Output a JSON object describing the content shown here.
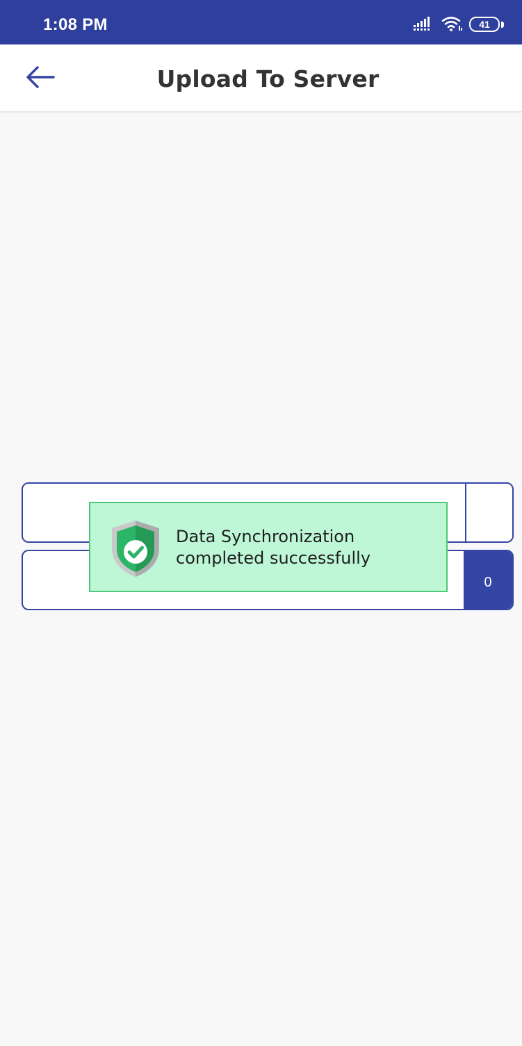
{
  "status_bar": {
    "time": "1:08 PM",
    "icons": [
      "signal-icon",
      "wifi-icon",
      "battery-icon"
    ],
    "battery_level": "41",
    "background_color": "#2f3f9e"
  },
  "header": {
    "back_icon": "arrow-left-icon",
    "title": "Upload To Server"
  },
  "upload_rows": [
    {
      "label": "",
      "count": ""
    },
    {
      "label": "",
      "count": "0"
    }
  ],
  "toast": {
    "icon": "shield-check-icon",
    "message": "Data Synchronization\ncompleted successfully",
    "background_color": "#bdf7d6",
    "border_color": "#4bc975"
  },
  "colors": {
    "primary": "#3445a3",
    "title_text": "#333333",
    "page_background": "#f8f8f8"
  }
}
